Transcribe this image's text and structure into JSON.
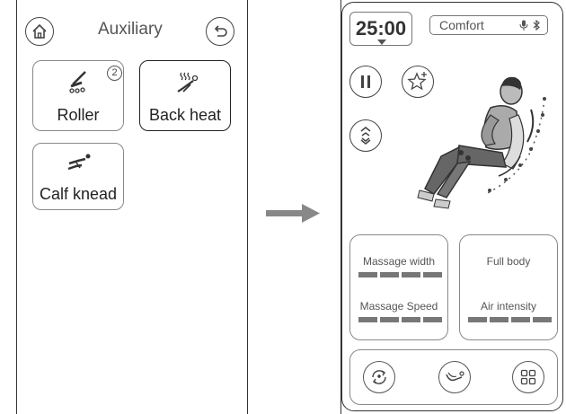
{
  "left": {
    "title": "Auxiliary",
    "home_icon": "home-icon",
    "back_icon": "back-arrow-icon",
    "tiles": [
      {
        "label": "Roller",
        "icon": "roller-icon",
        "badge": "2",
        "selected": false
      },
      {
        "label": "Back heat",
        "icon": "back-heat-icon",
        "selected": true
      },
      {
        "label": "Calf knead",
        "icon": "calf-knead-icon",
        "selected": false
      }
    ]
  },
  "arrow_icon": "right-arrow-icon",
  "right": {
    "timer": "25:00",
    "mode": "Comfort",
    "mode_icons": [
      "microphone-icon",
      "bluetooth-icon"
    ],
    "controls": [
      "pause-icon",
      "favorite-add-icon",
      "shoulder-adjust-icon"
    ],
    "card_left": {
      "width_label": "Massage width",
      "width_level": 4,
      "speed_label": "Massage Speed",
      "speed_level": 4
    },
    "card_right": {
      "area_label": "Full body",
      "air_label": "Air intensity",
      "air_level": 4
    },
    "bottom_buttons": [
      "auto-mode-icon",
      "manual-massage-icon",
      "menu-grid-icon"
    ]
  }
}
